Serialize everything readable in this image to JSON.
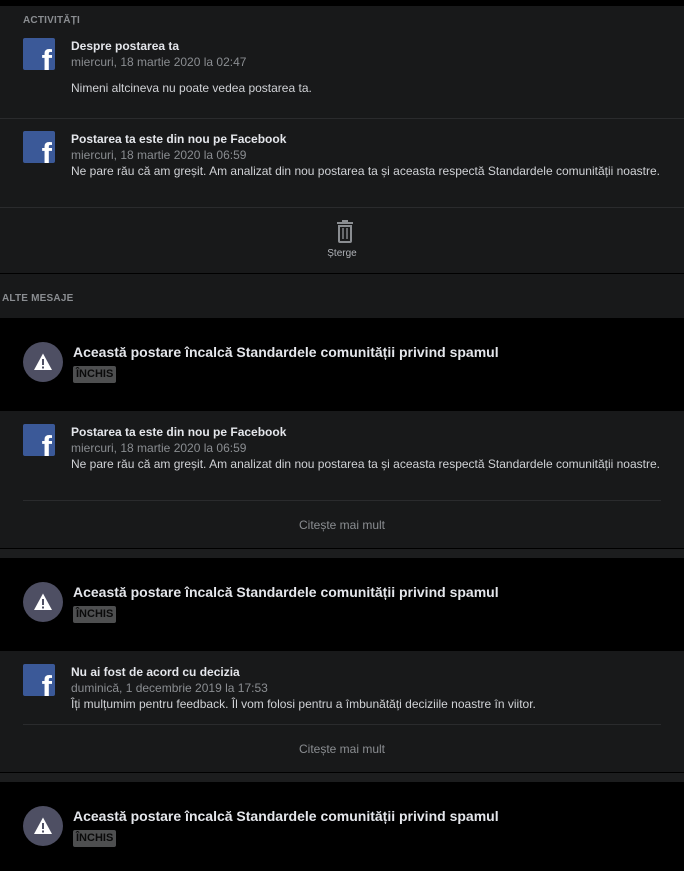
{
  "activities": {
    "header": "ACTIVITĂȚI",
    "items": [
      {
        "icon": "facebook-logo-icon",
        "title": "Despre postarea ta",
        "date": "miercuri, 18 martie 2020 la 02:47",
        "body": "Nimeni altcineva nu poate vedea postarea ta."
      },
      {
        "icon": "facebook-logo-icon",
        "title": "Postarea ta este din nou pe Facebook",
        "date": "miercuri, 18 martie 2020 la 06:59",
        "body": "Ne pare rău că am greșit. Am analizat din nou postarea ta și aceasta respectă Standardele comunității noastre."
      }
    ],
    "delete_label": "Șterge"
  },
  "other_messages": {
    "header": "ALTE MESAJE",
    "cards": [
      {
        "warning_title": "Această postare încalcă Standardele comunității privind spamul",
        "status_badge": "ÎNCHIS",
        "message": {
          "title": "Postarea ta este din nou pe Facebook",
          "date": "miercuri, 18 martie 2020 la 06:59",
          "body": "Ne pare rău că am greșit. Am analizat din nou postarea ta și aceasta respectă Standardele comunității noastre."
        },
        "read_more": "Citește mai mult"
      },
      {
        "warning_title": "Această postare încalcă Standardele comunității privind spamul",
        "status_badge": "ÎNCHIS",
        "message": {
          "title": "Nu ai fost de acord cu decizia",
          "date": "duminică, 1 decembrie 2019 la 17:53",
          "body": "Îți mulțumim pentru feedback. Îl vom folosi pentru a îmbunătăți deciziile noastre în viitor."
        },
        "read_more": "Citește mai mult"
      },
      {
        "warning_title": "Această postare încalcă Standardele comunității privind spamul",
        "status_badge": "ÎNCHIS"
      }
    ]
  },
  "colors": {
    "page_background": "#000000",
    "panel_background": "#18191a",
    "facebook_blue": "#3b5998",
    "warning_circle": "#4e4f63",
    "secondary_text": "#8a8d91"
  }
}
